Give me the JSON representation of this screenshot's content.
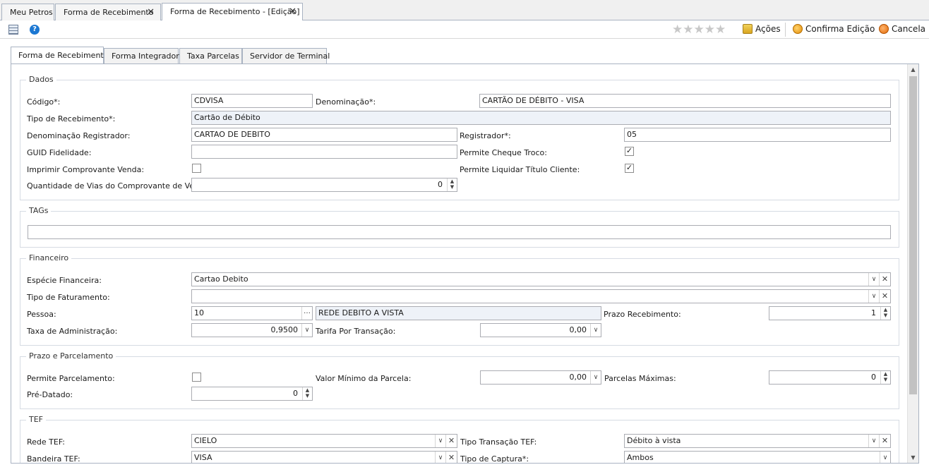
{
  "doc_tabs": [
    {
      "label": "Meu Petros"
    },
    {
      "label": "Forma de Recebimento"
    },
    {
      "label": "Forma de Recebimento - [Edição]"
    }
  ],
  "toolbar": {
    "stars": "★★★★★",
    "acoes": "Ações",
    "confirma": "Confirma Edição",
    "cancela": "Cancela"
  },
  "inner_tabs": [
    "Forma de Recebimento",
    "Forma Integrador",
    "Taxa Parcelas",
    "Servidor de Terminal"
  ],
  "dados": {
    "title": "Dados",
    "codigo_label": "Código*:",
    "codigo_value": "CDVISA",
    "denominacao_label": "Denominação*:",
    "denominacao_value": "CARTÃO DE DÉBITO - VISA",
    "tipo_label": "Tipo de Recebimento*:",
    "tipo_value": "Cartão de Débito",
    "den_reg_label": "Denominação Registrador:",
    "den_reg_value": "CARTAO DE DEBITO",
    "registrador_label": "Registrador*:",
    "registrador_value": "05",
    "guid_label": "GUID Fidelidade:",
    "guid_value": "",
    "cheque_label": "Permite Cheque Troco:",
    "cheque_checked": true,
    "imprimir_label": "Imprimir Comprovante Venda:",
    "imprimir_checked": false,
    "liquidar_label": "Permite Liquidar Título Cliente:",
    "liquidar_checked": true,
    "vias_label": "Quantidade de Vias do Comprovante de Venda:",
    "vias_value": "0"
  },
  "tags": {
    "title": "TAGs",
    "value": ""
  },
  "financeiro": {
    "title": "Financeiro",
    "especie_label": "Espécie Financeira:",
    "especie_value": "Cartao Debito",
    "faturamento_label": "Tipo de Faturamento:",
    "faturamento_value": "",
    "pessoa_label": "Pessoa:",
    "pessoa_code": "10",
    "pessoa_name": "REDE DEBITO A VISTA",
    "prazo_label": "Prazo Recebimento:",
    "prazo_value": "1",
    "taxa_label": "Taxa de Administração:",
    "taxa_value": "0,9500",
    "tarifa_label": "Tarifa Por Transação:",
    "tarifa_value": "0,00"
  },
  "prazo": {
    "title": "Prazo e Parcelamento",
    "parcelamento_label": "Permite Parcelamento:",
    "parcelamento_checked": false,
    "valor_min_label": "Valor Mínimo da Parcela:",
    "valor_min_value": "0,00",
    "parcelas_max_label": "Parcelas Máximas:",
    "parcelas_max_value": "0",
    "predatado_label": "Pré-Datado:",
    "predatado_value": "0"
  },
  "tef": {
    "title": "TEF",
    "rede_label": "Rede TEF:",
    "rede_value": "CIELO",
    "tipo_transacao_label": "Tipo Transação TEF:",
    "tipo_transacao_value": "Débito à vista",
    "bandeira_label": "Bandeira TEF:",
    "bandeira_value": "VISA",
    "captura_label": "Tipo de Captura*:",
    "captura_value": "Ambos"
  }
}
